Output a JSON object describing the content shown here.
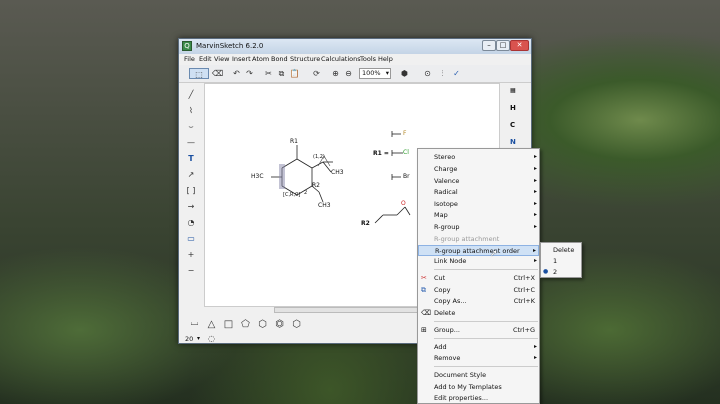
{
  "window": {
    "title": "MarvinSketch 6.2.0"
  },
  "menubar": [
    "File",
    "Edit",
    "View",
    "Insert",
    "Atom",
    "Bond",
    "Structure",
    "Calculations",
    "Tools",
    "Help"
  ],
  "toolbar": {
    "zoom": "100%"
  },
  "right_toolbar": [
    "H",
    "C",
    "N"
  ],
  "bottom": {
    "ring_size": "20"
  },
  "canvas": {
    "labels": {
      "r1": "R1",
      "h3c": "H3C",
      "r12": "(1,2)",
      "ch3a": "CH3",
      "cr0": "[C,R,0]",
      "r2a": "R2",
      "ch3b": "CH3",
      "two": "2",
      "f": "F",
      "r1eq": "R1 =",
      "cl": "Cl",
      "br": "Br",
      "r2b": "R2",
      "o": "O"
    }
  },
  "context_menu": [
    {
      "label": "Stereo",
      "arrow": "▸"
    },
    {
      "label": "Charge",
      "arrow": "▸"
    },
    {
      "label": "Valence",
      "arrow": "▸"
    },
    {
      "label": "Radical",
      "arrow": "▸"
    },
    {
      "label": "Isotope",
      "arrow": "▸"
    },
    {
      "label": "Map",
      "arrow": "▸"
    },
    {
      "label": "R-group",
      "arrow": "▸"
    },
    {
      "label": "R-group attachment"
    },
    {
      "label": "R-group attachment order",
      "arrow": "▸"
    },
    {
      "label": "Link Node",
      "arrow": "▸"
    },
    {
      "label": "Cut",
      "shortcut": "Ctrl+X"
    },
    {
      "label": "Copy",
      "shortcut": "Ctrl+C"
    },
    {
      "label": "Copy As...",
      "shortcut": "Ctrl+K"
    },
    {
      "label": "Delete"
    },
    {
      "label": "Group...",
      "shortcut": "Ctrl+G"
    },
    {
      "label": "Add",
      "arrow": "▸"
    },
    {
      "label": "Remove",
      "arrow": "▸"
    },
    {
      "label": "Document Style"
    },
    {
      "label": "Add to My Templates"
    },
    {
      "label": "Edit properties..."
    }
  ],
  "submenu": [
    {
      "label": "Delete"
    },
    {
      "label": "1"
    },
    {
      "label": "2"
    }
  ]
}
